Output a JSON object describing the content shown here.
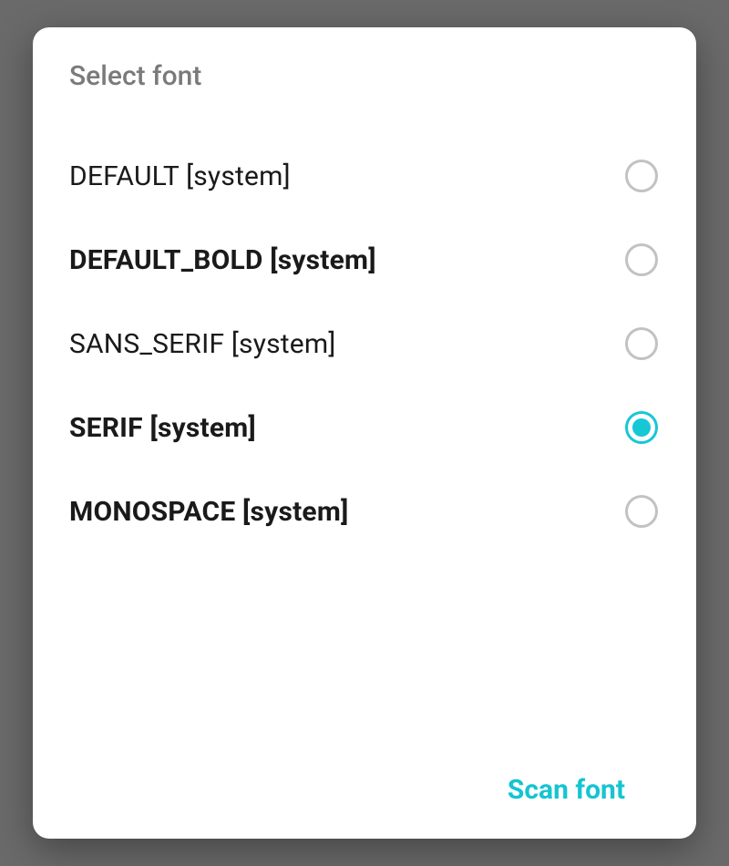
{
  "dialog": {
    "title": "Select font",
    "options": [
      {
        "label": "DEFAULT [system]",
        "bold": false,
        "selected": false
      },
      {
        "label": "DEFAULT_BOLD [system]",
        "bold": true,
        "selected": false
      },
      {
        "label": "SANS_SERIF [system]",
        "bold": false,
        "selected": false
      },
      {
        "label": "SERIF [system]",
        "bold": true,
        "selected": true
      },
      {
        "label": "MONOSPACE [system]",
        "bold": true,
        "selected": false
      }
    ],
    "action_label": "Scan font"
  },
  "colors": {
    "accent": "#16c7d6"
  }
}
